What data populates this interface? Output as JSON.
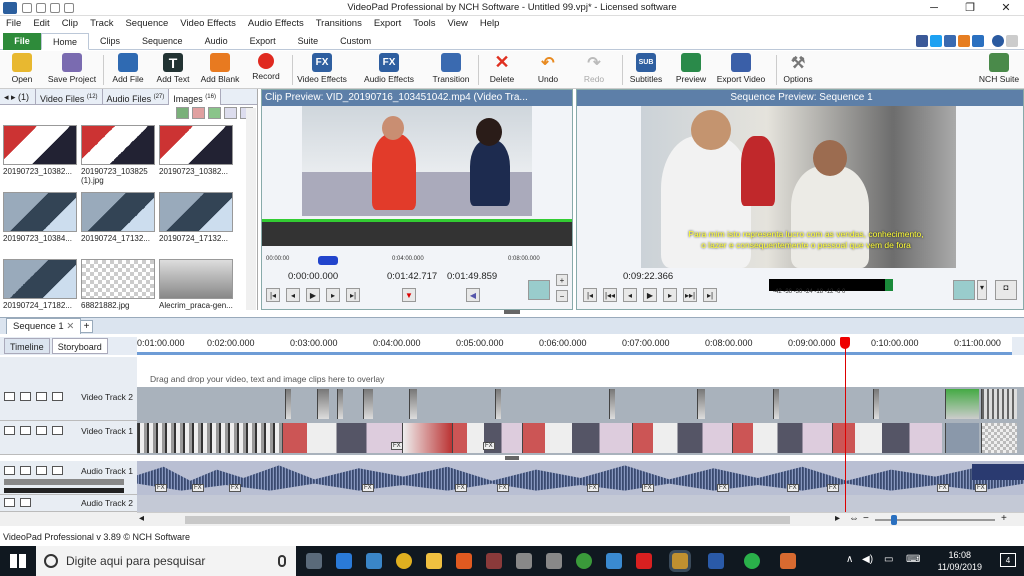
{
  "window": {
    "title": "VideoPad Professional by NCH Software - Untitled 99.vpj* - Licensed software",
    "min": "─",
    "max": "❐",
    "close": "✕"
  },
  "menu": [
    "File",
    "Edit",
    "Clip",
    "Track",
    "Sequence",
    "Video Effects",
    "Audio Effects",
    "Transitions",
    "Export",
    "Tools",
    "View",
    "Help"
  ],
  "ribbon_tabs": [
    "File",
    "Home",
    "Clips",
    "Sequence",
    "Audio",
    "Export",
    "Suite",
    "Custom"
  ],
  "toolbar": {
    "open": "Open",
    "save_project": "Save Project",
    "add_file": "Add File",
    "add_text": "Add Text",
    "add_blank": "Add Blank",
    "record": "Record",
    "video_effects": "Video Effects",
    "audio_effects": "Audio Effects",
    "transition": "Transition",
    "delete": "Delete",
    "undo": "Undo",
    "redo": "Redo",
    "subtitles": "Subtitles",
    "preview": "Preview",
    "export_video": "Export Video",
    "options": "Options",
    "nch_suite": "NCH Suite",
    "subtitles_icon": "SUB",
    "fx_icon": "FX"
  },
  "bin": {
    "tabs": [
      {
        "label": "(1)"
      },
      {
        "label": "Video Files",
        "count": "(12)"
      },
      {
        "label": "Audio Files",
        "count": "(27)"
      },
      {
        "label": "Images",
        "count": "(16)"
      }
    ],
    "items": [
      {
        "name": "20190723_10382..."
      },
      {
        "name": "20190723_103825 (1).jpg"
      },
      {
        "name": "20190723_10382..."
      },
      {
        "name": "20190723_10384..."
      },
      {
        "name": "20190724_17132..."
      },
      {
        "name": "20190724_17132..."
      },
      {
        "name": "20190724_17182..."
      },
      {
        "name": "68821882.jpg"
      },
      {
        "name": "Alecrim_praca-gen..."
      }
    ]
  },
  "clip_preview": {
    "title": "Clip Preview: VID_20190716_103451042.mp4 (Video Tra...",
    "time_current": "0:00:00.000",
    "time_in": "0:01:42.717",
    "time_out": "0:01:49.859",
    "ticks": [
      "00:00:00",
      "0:04:00.000",
      "0:08:00.000"
    ]
  },
  "sequence_preview": {
    "title": "Sequence Preview: Sequence 1",
    "time": "0:09:22.366",
    "subtitle_line1": "Para mim isto representa lucro com as vendas, conhecimento,",
    "subtitle_line2": "o lazer e consequentemente o pessoal que vem de fora",
    "meter_scale": "-42  -36  -30  -24  -18  -12  -6   0"
  },
  "sequence": {
    "tab": "Sequence 1",
    "add": "+",
    "close": "✕",
    "view_tabs": [
      "Timeline",
      "Storyboard"
    ],
    "ruler": [
      "0:01:00.000",
      "0:02:00.000",
      "0:03:00.000",
      "0:04:00.000",
      "0:05:00.000",
      "0:06:00.000",
      "0:07:00.000",
      "0:08:00.000",
      "0:09:00.000",
      "0:10:00.000",
      "0:11:00.000"
    ],
    "overlay_hint": "Drag and drop your video, text and image clips here to overlay",
    "tracks": {
      "video2": "Video Track 2",
      "video1": "Video Track 1",
      "audio1": "Audio Track 1",
      "audio2": "Audio Track 2"
    },
    "fx": "FX"
  },
  "status": "VideoPad Professional v 3.89 © NCH Software",
  "taskbar": {
    "search_placeholder": "Digite aqui para pesquisar",
    "time": "16:08",
    "date": "11/09/2019",
    "notif": "4"
  }
}
